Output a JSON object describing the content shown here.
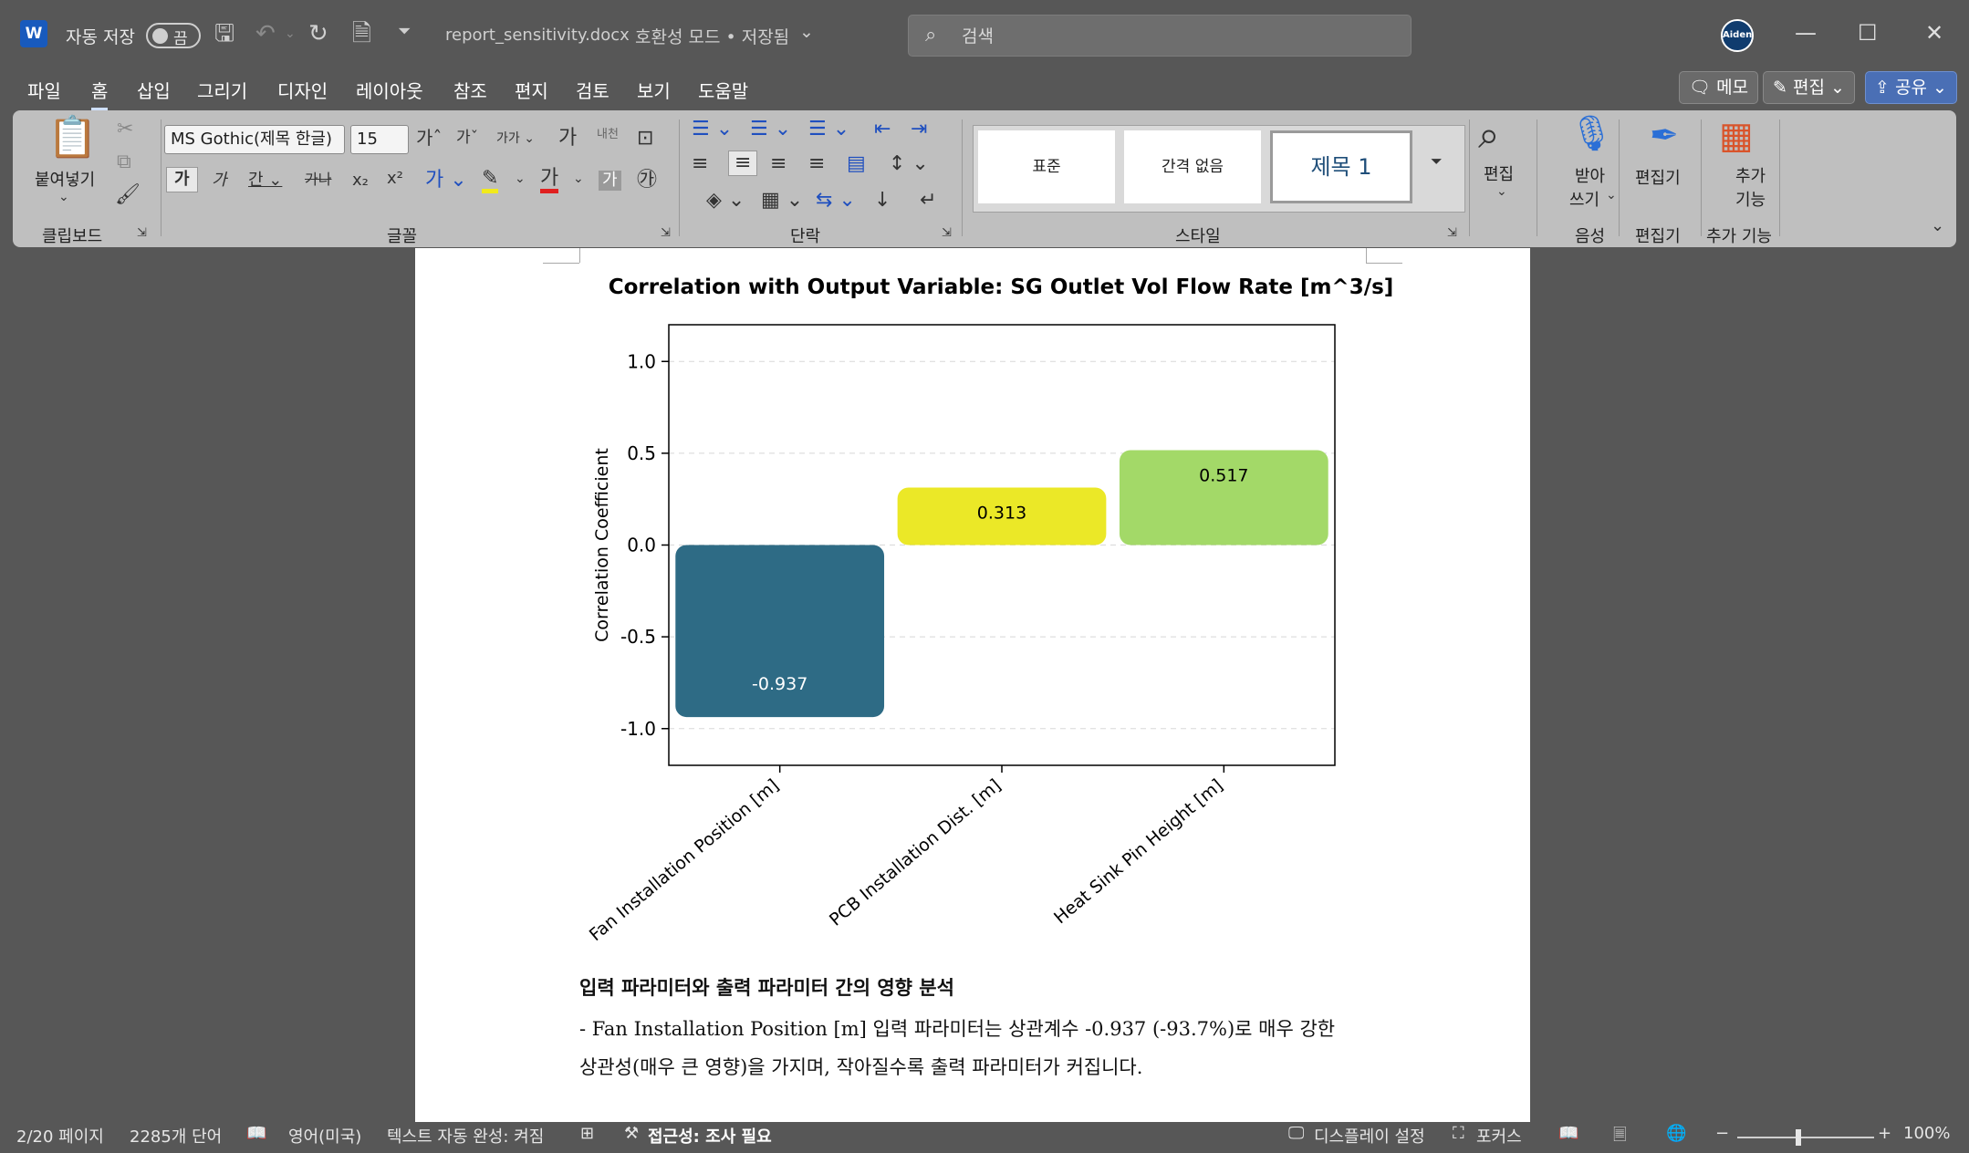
{
  "titlebar": {
    "autosave_label": "자동 저장",
    "autosave_state": "끔",
    "filename": "report_sensitivity.docx",
    "mode": "호환성 모드 • 저장됨",
    "search_placeholder": "검색",
    "user": "Aiden"
  },
  "menu": {
    "items": [
      "파일",
      "홈",
      "삽입",
      "그리기",
      "디자인",
      "레이아웃",
      "참조",
      "편지",
      "검토",
      "보기",
      "도움말"
    ],
    "active": "홈",
    "memo": "메모",
    "edit": "편집",
    "share": "공유"
  },
  "ribbon": {
    "clipboard": {
      "paste": "붙여넣기",
      "group": "클립보드"
    },
    "font": {
      "family": "MS Gothic(제목 한글)",
      "size": "15",
      "group": "글꼴"
    },
    "paragraph": {
      "group": "단락"
    },
    "styles": {
      "cards": [
        "표준",
        "간격 없음",
        "제목 1"
      ],
      "group": "스타일"
    },
    "editing": {
      "label": "편집"
    },
    "dictate": {
      "label_line1": "받아",
      "label_line2": "쓰기",
      "group": "음성"
    },
    "editor": {
      "label": "편집기",
      "group": "편집기"
    },
    "addins": {
      "label_line1": "추가",
      "label_line2": "기능",
      "group": "추가 기능"
    }
  },
  "chart_data": {
    "type": "bar",
    "title": "Correlation with Output Variable: SG Outlet Vol Flow Rate [m^3/s]",
    "xlabel": "",
    "ylabel": "Correlation Coefficient",
    "categories": [
      "Fan Installation Position [m]",
      "PCB Installation Dist. [m]",
      "Heat Sink Pin Height [m]"
    ],
    "values": [
      -0.937,
      0.313,
      0.517
    ],
    "labels": [
      "-0.937",
      "0.313",
      "0.517"
    ],
    "colors": [
      "#2e6b85",
      "#ebe827",
      "#a3d968"
    ],
    "ylim": [
      -1.2,
      1.2
    ],
    "yticks": [
      "1.0",
      "0.5",
      "0.0",
      "-0.5",
      "-1.0"
    ],
    "grid": "horizontal dashed"
  },
  "document": {
    "heading": "입력 파라미터와 출력 파라미터 간의 영향 분석",
    "para1_line1": "- Fan Installation Position [m] 입력 파라미터는 상관계수 -0.937 (-93.7%)로 매우 강한",
    "para1_line2": "상관성(매우 큰 영향)을 가지며, 작아질수록 출력 파라미터가 커집니다."
  },
  "statusbar": {
    "page": "2/20 페이지",
    "words": "2285개 단어",
    "language": "영어(미국)",
    "autocomplete": "텍스트 자동 완성: 켜짐",
    "accessibility": "접근성: 조사 필요",
    "display": "디스플레이 설정",
    "focus": "포커스",
    "zoom": "100%"
  }
}
